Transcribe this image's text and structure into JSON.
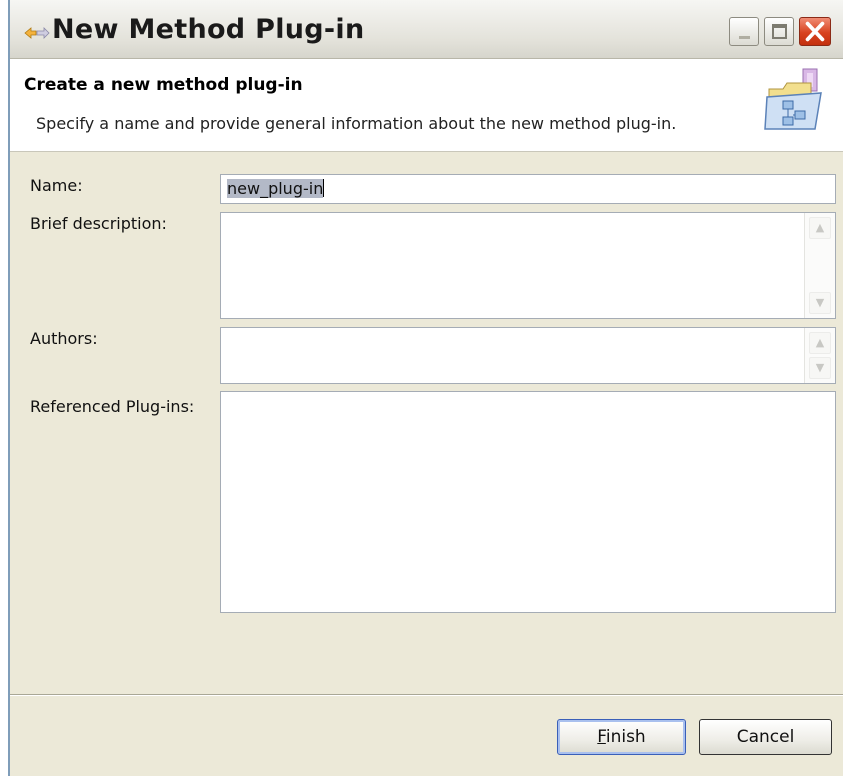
{
  "window": {
    "title": "New Method Plug-in",
    "icon": "wizard-arrow-icon"
  },
  "banner": {
    "title": "Create a new method plug-in",
    "description": "Specify a name and provide general information about the new method plug-in.",
    "icon": "plugin-folder-icon"
  },
  "form": {
    "name_label": "Name:",
    "name_value": "new_plug-in",
    "brief_description_label": "Brief description:",
    "brief_description_value": "",
    "authors_label": "Authors:",
    "authors_value": "",
    "referenced_plugins_label": "Referenced Plug-ins:"
  },
  "buttons": {
    "finish_mnemonic": "F",
    "finish_rest": "inish",
    "cancel": "Cancel"
  }
}
